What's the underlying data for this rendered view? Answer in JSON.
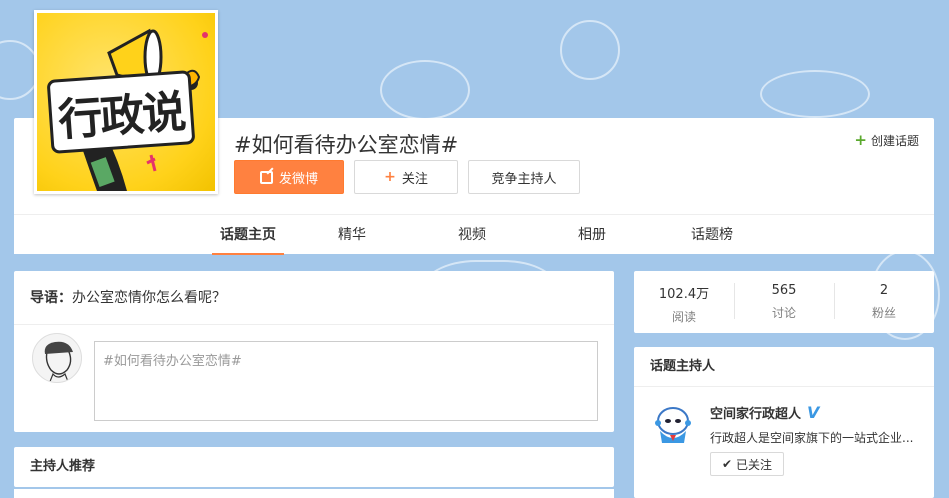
{
  "topic": {
    "title": "#如何看待办公室恋情#",
    "cover_text": "行政说",
    "create_label": "创建话题"
  },
  "actions": {
    "post_label": "发微博",
    "follow_label": "关注",
    "host_label": "竞争主持人"
  },
  "nav": {
    "tabs": [
      {
        "label": "话题主页",
        "active": true
      },
      {
        "label": "精华",
        "active": false
      },
      {
        "label": "视频",
        "active": false
      },
      {
        "label": "相册",
        "active": false
      },
      {
        "label": "话题榜",
        "active": false
      }
    ]
  },
  "intro": {
    "label": "导语：",
    "text": "办公室恋情你怎么看呢？",
    "compose_placeholder": "#如何看待办公室恋情#"
  },
  "host_recommend": {
    "title": "主持人推荐"
  },
  "stats": [
    {
      "value": "102.4万",
      "label": "阅读"
    },
    {
      "value": "565",
      "label": "讨论"
    },
    {
      "value": "2",
      "label": "粉丝"
    }
  ],
  "host": {
    "section_title": "话题主持人",
    "name": "空间家行政超人",
    "verified_mark": "V",
    "description": "行政超人是空间家旗下的一站式企业...",
    "followed_label": "已关注"
  },
  "colors": {
    "background": "#a3c7ea",
    "accent": "#ff8140",
    "verified": "#3b98e3",
    "create_plus": "#5ba92e"
  }
}
